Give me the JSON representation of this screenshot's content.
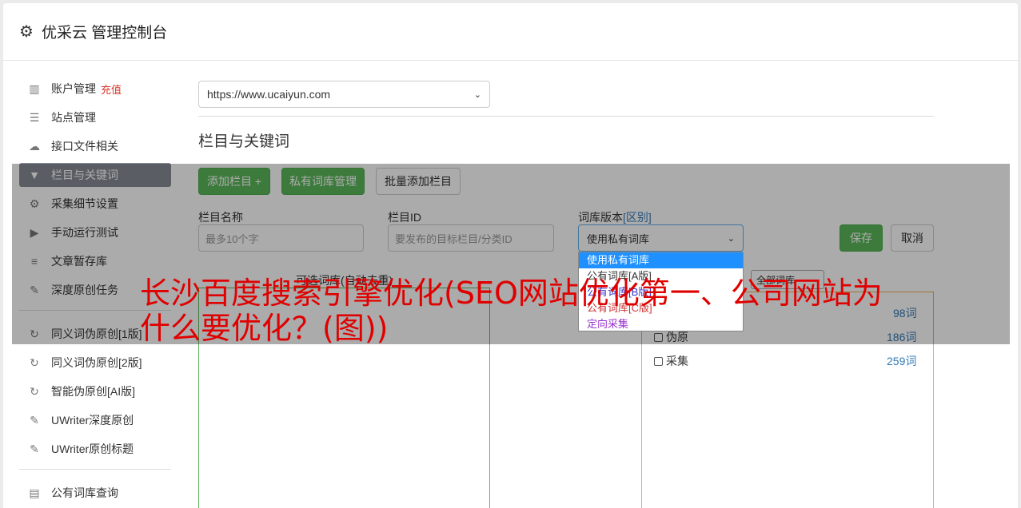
{
  "header": {
    "title": "优采云 管理控制台"
  },
  "sidebar": {
    "items": [
      {
        "label": "账户管理",
        "extra": "充值",
        "icon": "bar-chart-icon"
      },
      {
        "label": "站点管理",
        "icon": "server-icon"
      },
      {
        "label": "接口文件相关",
        "icon": "cloud-upload-icon"
      },
      {
        "label": "栏目与关键词",
        "icon": "filter-icon"
      },
      {
        "label": "采集细节设置",
        "icon": "cogs-icon"
      },
      {
        "label": "手动运行测试",
        "icon": "play-circle-icon"
      },
      {
        "label": "文章暂存库",
        "icon": "database-icon"
      },
      {
        "label": "深度原创任务",
        "icon": "edit-icon"
      },
      {
        "label": "同义词伪原创[1版]",
        "icon": "refresh-icon"
      },
      {
        "label": "同义词伪原创[2版]",
        "icon": "refresh-icon"
      },
      {
        "label": "智能伪原创[AI版]",
        "icon": "refresh-icon"
      },
      {
        "label": "UWriter深度原创",
        "icon": "edit-icon"
      },
      {
        "label": "UWriter原创标题",
        "icon": "edit-icon"
      },
      {
        "label": "公有词库查询",
        "icon": "book-icon"
      }
    ]
  },
  "main": {
    "site_select": "https://www.ucaiyun.com",
    "section_title": "栏目与关键词",
    "buttons": {
      "add_column": "添加栏目 +",
      "private_lib": "私有词库管理",
      "batch_add": "批量添加栏目",
      "save": "保存",
      "cancel": "取消"
    },
    "fields": {
      "name_label": "栏目名称",
      "name_placeholder": "最多10个字",
      "id_label": "栏目ID",
      "id_placeholder": "要发布的目标栏目/分类ID",
      "version_label": "词库版本",
      "version_link": "[区别]",
      "version_value": "使用私有词库"
    },
    "dropdown": [
      "使用私有词库",
      "公有词库[A版]",
      "公有词库[B版]",
      "公有词库[C版]",
      "定向采集"
    ],
    "dropdown_colors": [
      "#ffffff",
      "#333333",
      "#3333cc",
      "#cc3333",
      "#9933cc"
    ],
    "panel_title": "可选词库(自动去重)",
    "filter_select": "全部词库",
    "rows": [
      {
        "label": "",
        "count": "98词"
      },
      {
        "label": "伪原",
        "count": "186词"
      },
      {
        "label": "采集",
        "count": "259词"
      }
    ]
  },
  "ad": {
    "line": "长沙百度搜索引擎优化(SEO网站优化第一、公司网站为什么要优化？(图))"
  }
}
